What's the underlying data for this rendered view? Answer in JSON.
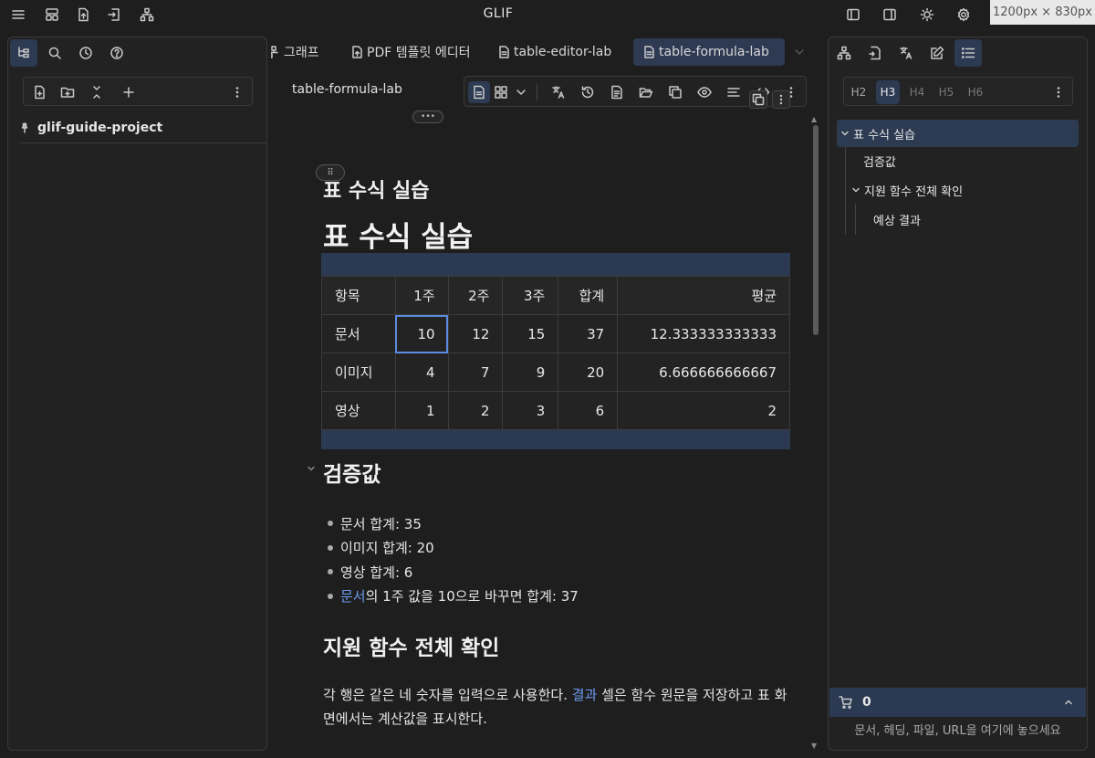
{
  "app": {
    "title": "GLIF",
    "dimension_badge": "1200px × 830px"
  },
  "title_icons": [
    "menu-icon",
    "layout-icon",
    "export-icon",
    "import-icon",
    "graph-icon",
    "left-sidebar-icon",
    "right-sidebar-icon",
    "theme-icon",
    "settings-icon"
  ],
  "left_panel": {
    "tabs": [
      "file-tree-icon",
      "search-icon",
      "history-icon",
      "help-icon"
    ],
    "toolbar": [
      "new-file-icon",
      "new-folder-icon",
      "collapse-icon",
      "add-icon",
      "more-icon"
    ],
    "project_name": "glif-guide-project"
  },
  "tabs": [
    {
      "label": "그래프",
      "icon": "graph-icon"
    },
    {
      "label": "PDF 템플릿 에디터",
      "icon": "pdf-template-icon"
    },
    {
      "label": "table-editor-lab",
      "icon": "document-icon"
    },
    {
      "label": "table-formula-lab",
      "icon": "document-icon",
      "active": true
    }
  ],
  "document": {
    "title": "table-formula-lab",
    "heading_small": "표 수식 실습",
    "heading_main": "표 수식 실습",
    "table": {
      "headers": [
        "항목",
        "1주",
        "2주",
        "3주",
        "합계",
        "평균"
      ],
      "rows": [
        [
          "문서",
          "10",
          "12",
          "15",
          "37",
          "12.333333333333"
        ],
        [
          "이미지",
          "4",
          "7",
          "9",
          "20",
          "6.666666666667"
        ],
        [
          "영상",
          "1",
          "2",
          "3",
          "6",
          "2"
        ]
      ]
    },
    "section_verify": "검증값",
    "bullets": [
      {
        "text": "문서 합계: 35"
      },
      {
        "text": "이미지 합계: 20"
      },
      {
        "text": "영상 합계: 6"
      },
      {
        "link": "문서",
        "text": "의 1주 값을 10으로 바꾸면 합계: 37"
      }
    ],
    "section_functions": "지원 함수 전체 확인",
    "paragraph_before": "각 행은 같은 네 숫자를 입력으로 사용한다. ",
    "paragraph_link": "결과",
    "paragraph_after": " 셀은 함수 원문을 저장하고 표 화면에서는 계산값을 표시한다."
  },
  "right_panel": {
    "heading_levels": [
      "H2",
      "H3",
      "H4",
      "H5",
      "H6"
    ],
    "active_level": "H3",
    "outline": [
      {
        "label": "표 수식 실습",
        "level": 0,
        "expanded": true,
        "active": true
      },
      {
        "label": "검증값",
        "level": 1
      },
      {
        "label": "지원 함수 전체 확인",
        "level": 1,
        "expanded": true
      },
      {
        "label": "예상 결과",
        "level": 2
      }
    ],
    "cart_count": "0",
    "drop_hint": "문서, 헤딩, 파일, URL을 여기에 놓으세요"
  }
}
